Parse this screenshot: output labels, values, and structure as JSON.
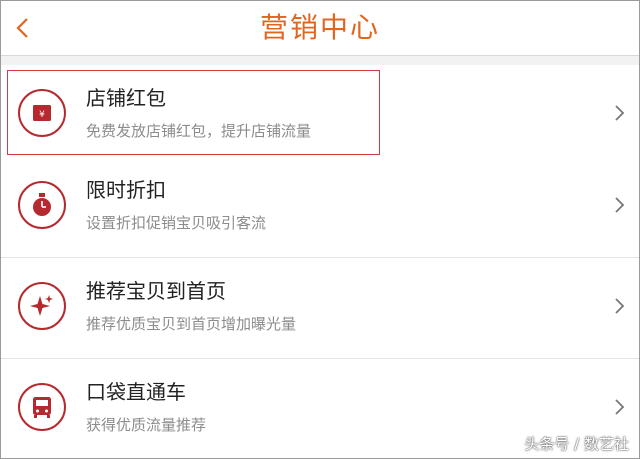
{
  "header": {
    "back_icon": "chevron-left-icon",
    "title": "营销中心"
  },
  "items": [
    {
      "title": "店铺红包",
      "desc": "免费发放店铺红包，提升店铺流量",
      "icon": "red-envelope-icon",
      "symbol": "¥"
    },
    {
      "title": "限时折扣",
      "desc": "设置折扣促销宝贝吸引客流",
      "icon": "stopwatch-icon"
    },
    {
      "title": "推荐宝贝到首页",
      "desc": "推荐优质宝贝到首页增加曝光量",
      "icon": "sparkle-icon"
    },
    {
      "title": "口袋直通车",
      "desc": "获得优质流量推荐",
      "icon": "bus-icon"
    }
  ],
  "watermark": "头条号 / 数艺社",
  "colors": {
    "accent": "#e0651f",
    "icon": "#b52a2e",
    "highlight": "#d23c3c"
  }
}
